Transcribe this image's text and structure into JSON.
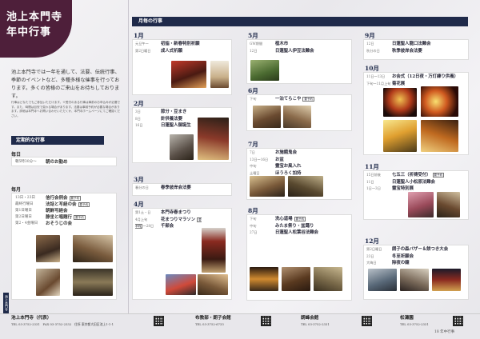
{
  "header": {
    "title_line1": "池上本門寺",
    "title_line2": "年中行事"
  },
  "intro": {
    "text": "池上本門寺では一年を通して、法要、伝統行事、季節のイベントなど、多種多様な催事を行っております。多くの皆様のご来山をお待ちしております。",
    "note": "行事はどなたでもご参加いただけます。※受付のある行事は事前のお申込みが必要です。また、時間は目安で変わる場合があります。法要は事前予約が必要な場合があります。詳細は本門寺へお問い合わせいただくか、本門寺ホームページにてご確認ください。"
  },
  "regular": {
    "heading": "定期的な行事",
    "daily_label": "毎日",
    "daily": [
      {
        "when": "朝5時30分〜",
        "what": "朝のお勤め"
      }
    ],
    "monthly_label": "毎月",
    "monthly": [
      {
        "when": "13日・23日",
        "what": "信行会例会",
        "tag": "要予約"
      },
      {
        "when": "最終行曜日",
        "what": "法話と写経の会",
        "tag": "要予約"
      },
      {
        "when": "第1日曜日",
        "what": "朝鮮写経会",
        "tag": ""
      },
      {
        "when": "第2日曜日",
        "what": "静坐と唱題行",
        "tag": "要予約"
      },
      {
        "when": "第2・4金曜日",
        "what": "おそうじの会",
        "tag": ""
      }
    ]
  },
  "monthly_heading": "月毎の行事",
  "months": {
    "jan": {
      "label": "1月",
      "entries": [
        {
          "d": "元旦午〜",
          "t": "初詣・新春特別祈願"
        },
        {
          "d": "第2日曜日",
          "t": "成人式祈願"
        }
      ]
    },
    "feb": {
      "label": "2月",
      "entries": [
        {
          "d": "3日",
          "t": "節分・豆まき"
        },
        {
          "d": "8日",
          "t": "針供養法要"
        },
        {
          "d": "16日",
          "t": "日蓮聖人御誕生"
        }
      ]
    },
    "mar": {
      "label": "3月",
      "entries": [
        {
          "d": "春分の日",
          "t": "春季彼岸会法要"
        }
      ]
    },
    "apr": {
      "label": "4月",
      "entries": [
        {
          "d": "第1土・日",
          "t": "本門寺春まつり"
        },
        {
          "d": "4月上旬",
          "t": "花まつりマラソン",
          "tag": "要予約"
        },
        {
          "d": "27日〜28日",
          "t": "千部会"
        }
      ]
    },
    "may": {
      "label": "5月",
      "entries": [
        {
          "d": "GW期間",
          "t": "植木市"
        },
        {
          "d": "12日",
          "t": "日蓮聖人伊豆法難会"
        }
      ]
    },
    "jun": {
      "label": "6月",
      "entries": [
        {
          "d": "下旬",
          "t": "一泊てらこや",
          "tag": "要予約"
        }
      ]
    },
    "jul": {
      "label": "7月",
      "entries": [
        {
          "d": "7日",
          "t": "お施餓鬼会"
        },
        {
          "d": "13日〜16日",
          "t": "お盆"
        },
        {
          "d": "中旬",
          "t": "霊宝お風入れ"
        },
        {
          "d": "土曜日",
          "t": "ほうろく加持"
        }
      ]
    },
    "aug": {
      "label": "8月",
      "entries": [
        {
          "d": "下旬",
          "t": "洗心道場",
          "tag": "要予約"
        },
        {
          "d": "中旬",
          "t": "みたま祭り・盆踊り"
        },
        {
          "d": "27日",
          "t": "日蓮聖人松葉谷法難会"
        }
      ]
    },
    "sep": {
      "label": "9月",
      "entries": [
        {
          "d": "12日",
          "t": "日蓮聖人龍口法難会"
        },
        {
          "d": "秋分の日",
          "t": "秋季彼岸会法要"
        }
      ]
    },
    "oct": {
      "label": "10月",
      "entries": [
        {
          "d": "11日〜13日",
          "t": "お会式（12日夜・万灯練り供養）"
        },
        {
          "d": "下旬〜11月上旬",
          "t": "菊花展"
        }
      ]
    },
    "nov": {
      "label": "11月",
      "entries": [
        {
          "d": "15日前後",
          "t": "七五三（祈祷受付）",
          "tag": "要予約"
        },
        {
          "d": "11日",
          "t": "日蓮聖人小松原法難会"
        },
        {
          "d": "1日〜3日",
          "t": "霊宝特別展"
        }
      ]
    },
    "dec": {
      "label": "12月",
      "entries": [
        {
          "d": "第2日曜日",
          "t": "朗子の森バザー＆餅つき大会"
        },
        {
          "d": "23日",
          "t": "冬至祈願会"
        },
        {
          "d": "大晦日",
          "t": "除夜の鐘"
        }
      ]
    }
  },
  "footer": {
    "orgs": [
      {
        "name": "池上本門寺（代表）",
        "lines": "TEL 03-3752-2331　FAX 03-3752-2332　住所 東京都大田区池上1-1-1"
      },
      {
        "name": "布教部・朗子会館",
        "lines": "TEL 03-3752-6733"
      },
      {
        "name": "朗峰会館",
        "lines": "TEL 03-3752-2331"
      },
      {
        "name": "松濤園",
        "lines": "TEL 03-3752-2331"
      }
    ],
    "page_tab": "池上本門寺",
    "page_number": "18 年中行事"
  }
}
